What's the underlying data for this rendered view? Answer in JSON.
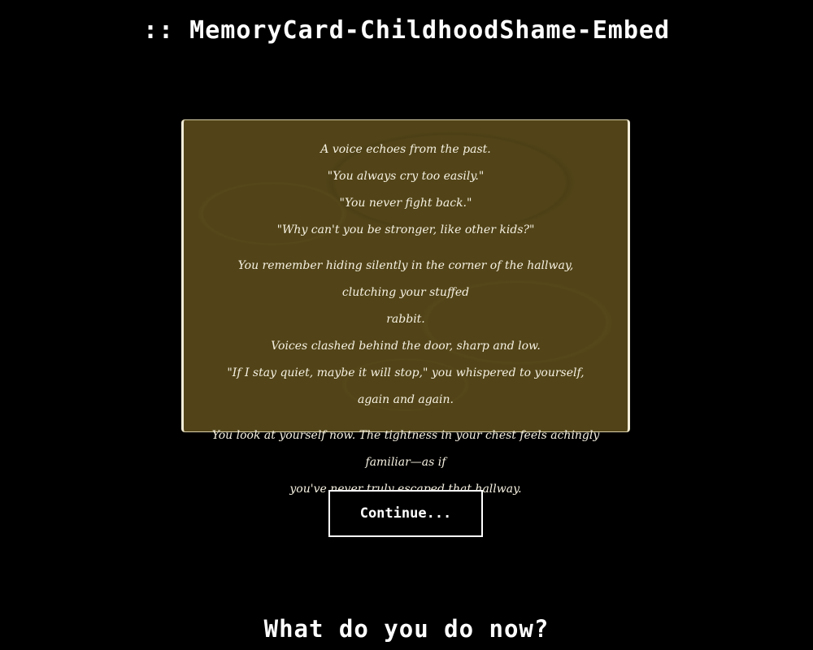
{
  "header": {
    "title": ":: MemoryCard-ChildhoodShame-Embed"
  },
  "memory_card": {
    "paragraphs": [
      {
        "lines": [
          "A voice echoes from the past.",
          "\"You always cry too easily.\"",
          "\"You never fight back.\"",
          "\"Why can't you be stronger, like other kids?\""
        ]
      },
      {
        "lines": [
          "You remember hiding silently in the corner of the hallway, clutching your stuffed",
          "rabbit.",
          "Voices clashed behind the door, sharp and low.",
          "\"If I stay quiet, maybe it will stop,\" you whispered to yourself, again and again."
        ]
      },
      {
        "lines": [
          "You look at yourself now. The tightness in your chest feels achingly familiar—as if",
          "you've never truly escaped that hallway."
        ]
      }
    ]
  },
  "actions": {
    "continue_label": "Continue..."
  },
  "footer": {
    "prompt": "What do you do now?"
  },
  "colors": {
    "background": "#000000",
    "card": "#524418",
    "text": "#ffffff"
  }
}
